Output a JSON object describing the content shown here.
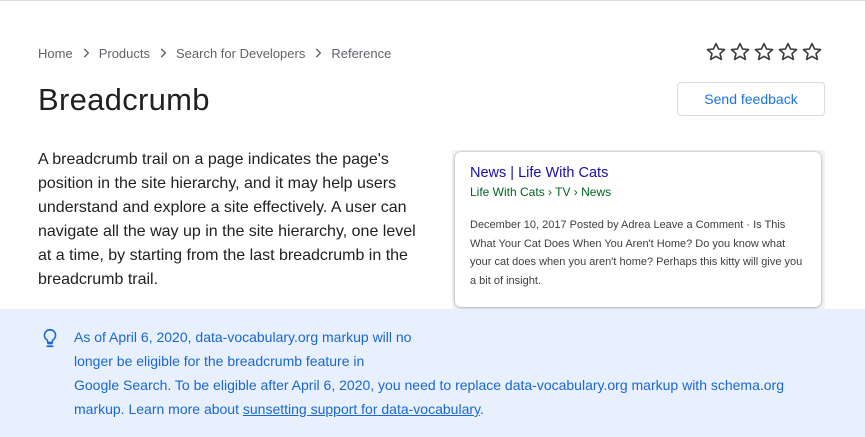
{
  "breadcrumb": {
    "items": [
      "Home",
      "Products",
      "Search for Developers",
      "Reference"
    ]
  },
  "rating": {
    "stars": 5,
    "filled": 0
  },
  "page": {
    "title": "Breadcrumb",
    "feedback_label": "Send feedback",
    "intro": "A breadcrumb trail on a page indicates the page's position in the site hierarchy, and it may help users understand and explore a site effectively. A user can navigate all the way up in the site hierarchy, one level at a time, by starting from the last breadcrumb in the breadcrumb trail."
  },
  "serp_example": {
    "title": "News | Life With Cats",
    "crumb": "Life With Cats › TV › News",
    "snippet": "December 10, 2017 Posted by Adrea Leave a Comment · Is This What Your Cat Does When You Aren't Home? Do you know what your cat does when you aren't home? Perhaps this kitty will give you a bit of insight."
  },
  "notice": {
    "icon": "lightbulb-icon",
    "line1": "As of April 6, 2020, data-vocabulary.org markup will no longer be eligible for the breadcrumb feature in",
    "line2": "Google Search. To be eligible after April 6, 2020, you need to replace data-vocabulary.org markup with schema.org markup. Learn more about ",
    "link_text": "sunsetting support for data-vocabulary",
    "after_link": "."
  },
  "colors": {
    "link_blue": "#1a73e8",
    "notice_bg": "#e8f0fe",
    "notice_text": "#1967d2",
    "serp_title": "#1a0dab",
    "serp_crumb": "#006621"
  }
}
